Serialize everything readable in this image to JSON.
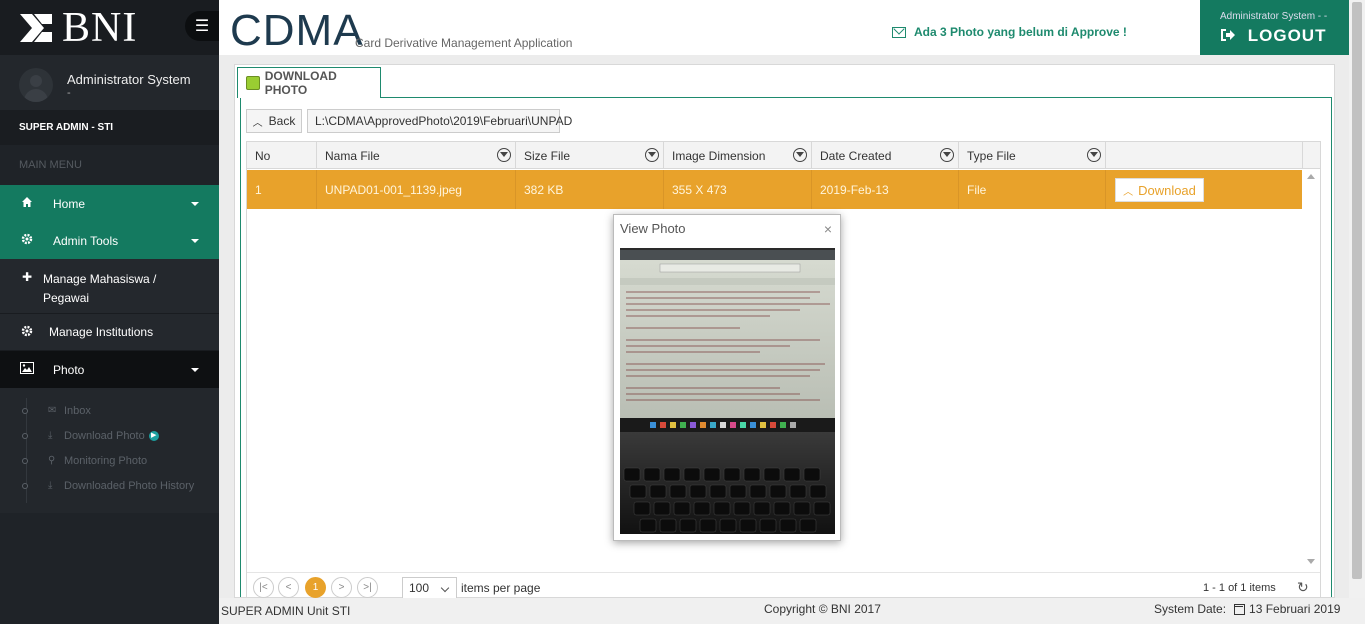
{
  "sidebar": {
    "logo_text": "BNI",
    "profile_name": "Administrator System",
    "profile_sub": "-",
    "role": "SUPER ADMIN - STI",
    "menu_header": "MAIN MENU",
    "items": [
      {
        "label": "Home"
      },
      {
        "label": "Admin Tools"
      },
      {
        "label": "Manage Mahasiswa / Pegawai"
      },
      {
        "label": "Manage Institutions"
      },
      {
        "label": "Photo"
      }
    ],
    "photo_sub": [
      {
        "label": "Inbox"
      },
      {
        "label": "Download Photo"
      },
      {
        "label": "Monitoring Photo"
      },
      {
        "label": "Downloaded Photo History"
      }
    ]
  },
  "header": {
    "title": "CDMA",
    "subtitle": "Card Derivative Management Application",
    "notification": "Ada 3 Photo yang belum di Approve !",
    "user": "Administrator System - -",
    "logout_label": "LOGOUT"
  },
  "content": {
    "tab_label": "DOWNLOAD PHOTO",
    "back_label": "Back",
    "path": "L:\\CDMA\\ApprovedPhoto\\2019\\Februari\\UNPAD",
    "columns": [
      "No",
      "Nama File",
      "Size File",
      "Image Dimension",
      "Date Created",
      "Type File"
    ],
    "rows": [
      {
        "no": "1",
        "file": "UNPAD01-001_1139.jpeg",
        "size": "382 KB",
        "dim": "355 X 473",
        "date": "2019-Feb-13",
        "type": "File",
        "action": "Download"
      }
    ],
    "pager": {
      "page": "1",
      "page_size": "100",
      "items_label": "items per page",
      "info": "1 - 1 of 1 items"
    }
  },
  "modal": {
    "title": "View Photo",
    "close": "×"
  },
  "footer": {
    "left": "SUPER ADMIN Unit STI",
    "copyright": "Copyright © BNI 2017",
    "system_date_label": "System Date:",
    "system_date": "13 Februari 2019"
  },
  "colors": {
    "accent": "#147a60",
    "row_highlight": "#e8a22b",
    "sidebar": "#1f2328"
  }
}
